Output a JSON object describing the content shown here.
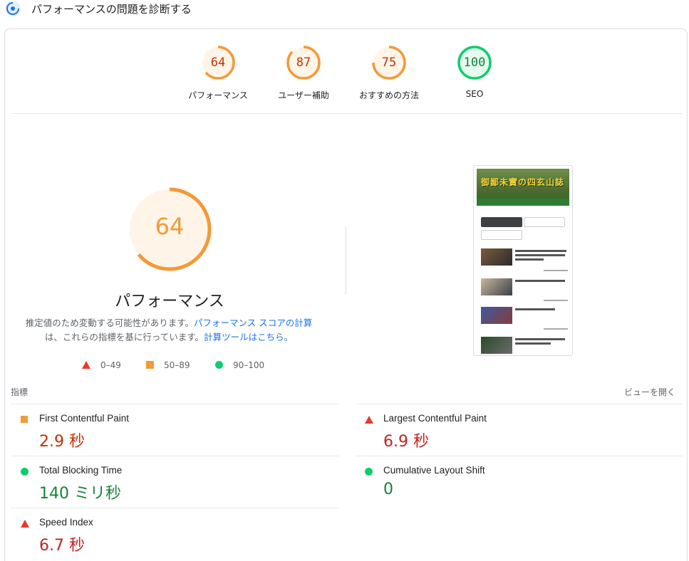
{
  "header": {
    "title": "パフォーマンスの問題を診断する"
  },
  "categories": [
    {
      "score": "64",
      "label": "パフォーマンス",
      "value": 64,
      "color": "#f29a38",
      "bg": "#fef4e8",
      "text_color": "#c33300"
    },
    {
      "score": "87",
      "label": "ユーザー補助",
      "value": 87,
      "color": "#f29a38",
      "bg": "#fef4e8",
      "text_color": "#c33300"
    },
    {
      "score": "75",
      "label": "おすすめの方法",
      "value": 75,
      "color": "#f29a38",
      "bg": "#fef4e8",
      "text_color": "#c33300"
    },
    {
      "score": "100",
      "label": "SEO",
      "value": 100,
      "color": "#0cce6b",
      "bg": "#e6faef",
      "text_color": "#188038"
    }
  ],
  "summary": {
    "score": "64",
    "value": 64,
    "label": "パフォーマンス",
    "desc_1": "推定値のため変動する可能性があります。",
    "desc_link_1": "パフォーマンス スコアの計算",
    "desc_2": "は、これらの指標を基に行っています。",
    "desc_link_2": "計算ツールはこちら。"
  },
  "legend": {
    "fail": "0–49",
    "average": "50–89",
    "pass": "90–100"
  },
  "screenshot": {
    "banner_text": "御鄙未實の四玄山誌"
  },
  "metrics_section": {
    "label": "指標",
    "expand_label": "ビューを開く"
  },
  "metrics": {
    "fcp": {
      "name": "First Contentful Paint",
      "value": "2.9 秒",
      "status": "average"
    },
    "lcp": {
      "name": "Largest Contentful Paint",
      "value": "6.9 秒",
      "status": "fail"
    },
    "tbt": {
      "name": "Total Blocking Time",
      "value": "140 ミリ秒",
      "status": "pass"
    },
    "cls": {
      "name": "Cumulative Layout Shift",
      "value": "0",
      "status": "pass"
    },
    "si": {
      "name": "Speed Index",
      "value": "6.7 秒",
      "status": "fail"
    }
  },
  "colors": {
    "fail": "#e63a2e",
    "average": "#f29a38",
    "pass": "#0cce6b",
    "link": "#1a73e8"
  }
}
